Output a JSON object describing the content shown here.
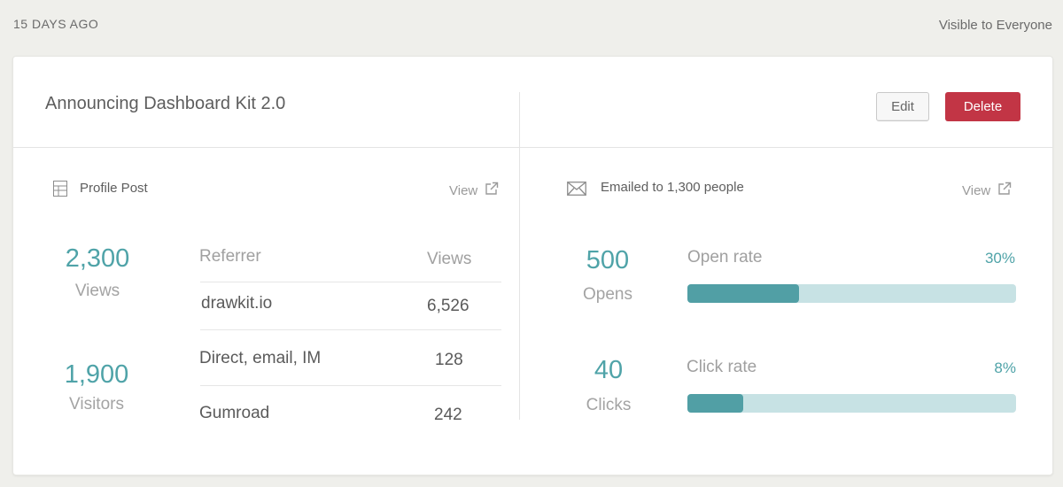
{
  "meta": {
    "posted": "15 DAYS AGO",
    "visibility": "Visible to Everyone"
  },
  "header": {
    "title": "Announcing Dashboard Kit 2.0",
    "edit_label": "Edit",
    "delete_label": "Delete"
  },
  "profile_panel": {
    "icon": "table-icon",
    "label": "Profile Post",
    "view_label": "View",
    "stats": [
      {
        "value": "2,300",
        "label": "Views"
      },
      {
        "value": "1,900",
        "label": "Visitors"
      }
    ],
    "table": {
      "columns": [
        "Referrer",
        "Views"
      ],
      "rows": [
        [
          "drawkit.io",
          "6,526"
        ],
        [
          "Direct, email, IM",
          "128"
        ],
        [
          "Gumroad",
          "242"
        ]
      ]
    }
  },
  "email_panel": {
    "icon": "envelope-icon",
    "label": "Emailed to 1,300 people",
    "view_label": "View",
    "stats": [
      {
        "value": "500",
        "label": "Opens"
      },
      {
        "value": "40",
        "label": "Clicks"
      }
    ],
    "rates": [
      {
        "label": "Open rate",
        "percent_text": "30%",
        "fill_fraction": 0.34
      },
      {
        "label": "Click rate",
        "percent_text": "8%",
        "fill_fraction": 0.17
      }
    ]
  },
  "colors": {
    "accent": "#4fa3a8",
    "bar_track": "#c7e2e4",
    "bar_fill": "#519fa5",
    "delete_button": "#c23545"
  }
}
